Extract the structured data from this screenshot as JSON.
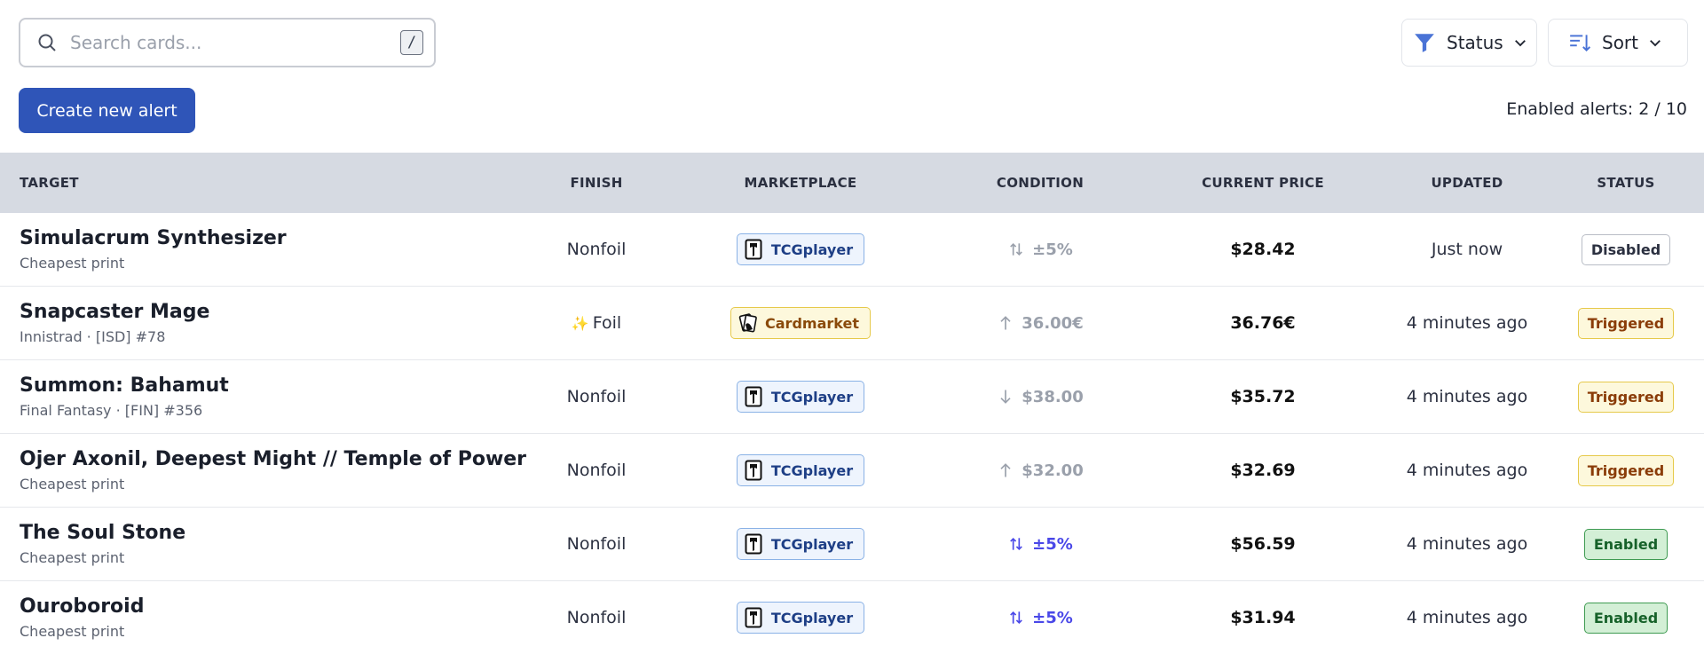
{
  "search": {
    "placeholder": "Search cards...",
    "value": "",
    "shortcut": "/"
  },
  "filters": {
    "status_label": "Status",
    "sort_label": "Sort"
  },
  "actions": {
    "create_label": "Create new alert"
  },
  "summary": {
    "enabled_text": "Enabled alerts: 2 / 10"
  },
  "colors": {
    "primary": "#2f55b8",
    "funnel": "#4a73d6",
    "header_bg": "#d6dae2",
    "cond_muted": "#9aa0ab",
    "cond_active": "#4a48e8"
  },
  "table": {
    "headers": {
      "target": "TARGET",
      "finish": "FINISH",
      "marketplace": "MARKETPLACE",
      "condition": "CONDITION",
      "current_price": "CURRENT PRICE",
      "updated": "UPDATED",
      "status": "STATUS"
    },
    "rows": [
      {
        "name": "Simulacrum Synthesizer",
        "sub": "Cheapest print",
        "finish": "Nonfoil",
        "foil": false,
        "marketplace": "TCGplayer",
        "market_type": "tcg",
        "cond_icon": "both-arrows-icon",
        "cond_value": "±5%",
        "cond_active": false,
        "price": "$28.42",
        "updated": "Just now",
        "status": "Disabled",
        "status_type": "disabled"
      },
      {
        "name": "Snapcaster Mage",
        "sub": "Innistrad · [ISD] #78",
        "finish": "Foil",
        "foil": true,
        "marketplace": "Cardmarket",
        "market_type": "cm",
        "cond_icon": "arrow-up-icon",
        "cond_value": "36.00€",
        "cond_active": false,
        "price": "36.76€",
        "updated": "4 minutes ago",
        "status": "Triggered",
        "status_type": "triggered"
      },
      {
        "name": "Summon: Bahamut",
        "sub": "Final Fantasy · [FIN] #356",
        "finish": "Nonfoil",
        "foil": false,
        "marketplace": "TCGplayer",
        "market_type": "tcg",
        "cond_icon": "arrow-down-icon",
        "cond_value": "$38.00",
        "cond_active": false,
        "price": "$35.72",
        "updated": "4 minutes ago",
        "status": "Triggered",
        "status_type": "triggered"
      },
      {
        "name": "Ojer Axonil, Deepest Might // Temple of Power",
        "sub": "Cheapest print",
        "finish": "Nonfoil",
        "foil": false,
        "marketplace": "TCGplayer",
        "market_type": "tcg",
        "cond_icon": "arrow-up-icon",
        "cond_value": "$32.00",
        "cond_active": false,
        "price": "$32.69",
        "updated": "4 minutes ago",
        "status": "Triggered",
        "status_type": "triggered"
      },
      {
        "name": "The Soul Stone",
        "sub": "Cheapest print",
        "finish": "Nonfoil",
        "foil": false,
        "marketplace": "TCGplayer",
        "market_type": "tcg",
        "cond_icon": "both-arrows-icon",
        "cond_value": "±5%",
        "cond_active": true,
        "price": "$56.59",
        "updated": "4 minutes ago",
        "status": "Enabled",
        "status_type": "enabled"
      },
      {
        "name": "Ouroboroid",
        "sub": "Cheapest print",
        "finish": "Nonfoil",
        "foil": false,
        "marketplace": "TCGplayer",
        "market_type": "tcg",
        "cond_icon": "both-arrows-icon",
        "cond_value": "±5%",
        "cond_active": true,
        "price": "$31.94",
        "updated": "4 minutes ago",
        "status": "Enabled",
        "status_type": "enabled"
      }
    ]
  }
}
